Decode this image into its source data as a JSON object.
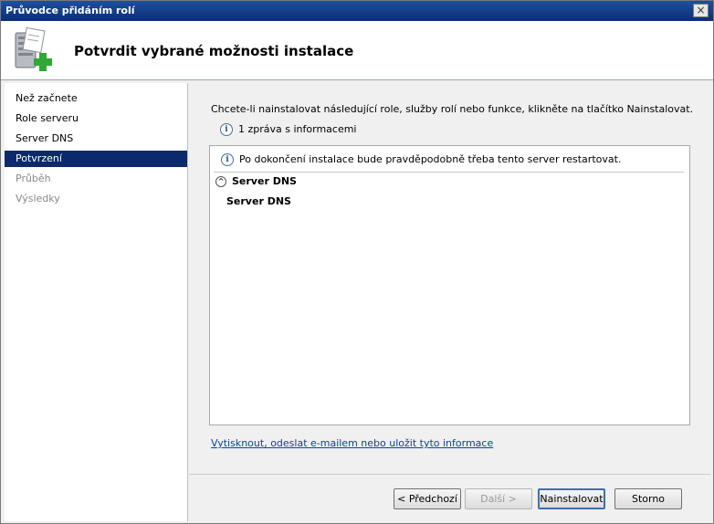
{
  "window": {
    "title": "Průvodce přidáním rolí",
    "close_glyph": "×"
  },
  "header": {
    "title": "Potvrdit vybrané možnosti instalace",
    "icon": "server-add-icon"
  },
  "sidebar": {
    "items": [
      {
        "label": "Než začnete",
        "state": "normal"
      },
      {
        "label": "Role serveru",
        "state": "normal"
      },
      {
        "label": "Server DNS",
        "state": "normal"
      },
      {
        "label": "Potvrzení",
        "state": "active"
      },
      {
        "label": "Průběh",
        "state": "disabled"
      },
      {
        "label": "Výsledky",
        "state": "disabled"
      }
    ]
  },
  "main": {
    "instruction": "Chcete-li nainstalovat následující role, služby rolí nebo funkce, klikněte na tlačítko Nainstalovat.",
    "message_count": "1 zpráva s informacemi",
    "listbox": {
      "info_message": "Po dokončení instalace bude pravděpodobně třeba tento server restartovat.",
      "group_title": "Server DNS",
      "role_title": "Server DNS"
    },
    "link": "Vytisknout, odeslat e-mailem nebo uložit tyto informace"
  },
  "footer": {
    "previous": "< Předchozí",
    "next": "Další >",
    "install": "Nainstalovat",
    "cancel": "Storno"
  }
}
